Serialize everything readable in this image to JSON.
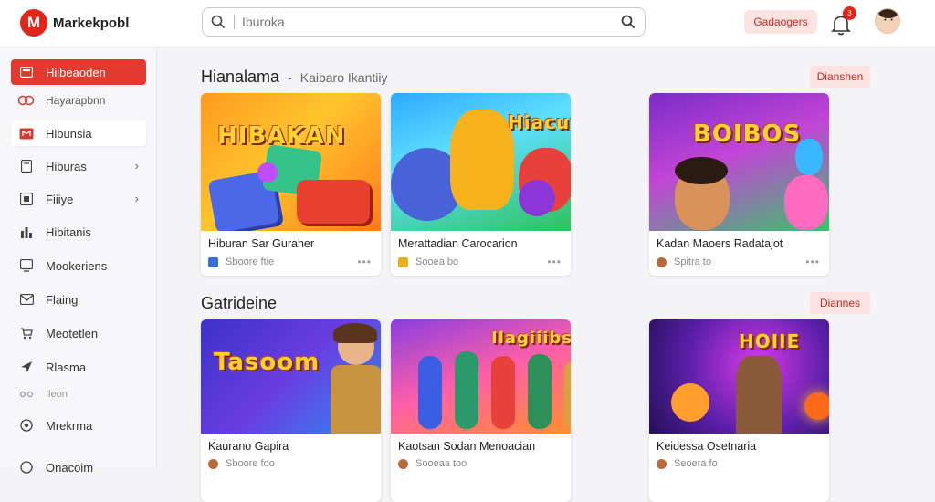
{
  "app": {
    "brand_letter": "M",
    "brand_name": "Markekpobl"
  },
  "search": {
    "placeholder": "Iburoka"
  },
  "header": {
    "action_label": "Gadaogers",
    "notification_count": "3"
  },
  "sidebar": {
    "items": [
      {
        "label": "Hiibeaoden",
        "icon": "home-icon",
        "state": "active"
      },
      {
        "label": "Hayarapbnn",
        "icon": "friends-icon",
        "state": "normal"
      },
      {
        "label": "Hibunsia",
        "icon": "video-icon",
        "state": "selected"
      },
      {
        "label": "Hiburas",
        "icon": "tablet-icon",
        "state": "normal",
        "chevron": true
      },
      {
        "label": "Fiiiye",
        "icon": "grid-icon",
        "state": "normal",
        "chevron": true
      },
      {
        "label": "Hibitanis",
        "icon": "bars-icon",
        "state": "normal"
      },
      {
        "label": "Mookeriens",
        "icon": "monitor-icon",
        "state": "normal"
      },
      {
        "label": "Flaing",
        "icon": "mail-icon",
        "state": "normal"
      },
      {
        "label": "Meotetlen",
        "icon": "cart-icon",
        "state": "normal"
      },
      {
        "label": "Rlasma",
        "icon": "send-icon",
        "state": "normal"
      },
      {
        "label": "Ileon",
        "icon": "link-icon",
        "state": "muted"
      },
      {
        "label": "Mrekrma",
        "icon": "settings-icon",
        "state": "normal"
      },
      {
        "label": "Onacoim",
        "icon": "help-icon",
        "state": "normal"
      }
    ]
  },
  "sections": [
    {
      "title": "Hianalama",
      "subtitle": "Kaibaro Ikantiiy",
      "see_all": "Dianshen",
      "cards": [
        {
          "title": "Hiburan Sar Guraher",
          "meta": "Sboore ftie",
          "meta_color": "#3a6fd8",
          "art": "HIBAKAN"
        },
        {
          "title": "Merattadian Carocarion",
          "meta": "Sooea bo",
          "meta_color": "#e5b21c",
          "art": "Hiacuvay"
        },
        {
          "title": "Kadan Maoers Radatajot",
          "meta": "Spitra to",
          "meta_color": "#b86b3a",
          "art": "BOIBOS"
        }
      ]
    },
    {
      "title": "Gatrideine",
      "subtitle": "",
      "see_all": "Diannes",
      "cards": [
        {
          "title": "Kaurano Gapira",
          "meta": "Sboore foo",
          "meta_color": "#b86b3a",
          "art": "Tasoom"
        },
        {
          "title": "Kaotsan Sodan Menoacian",
          "meta": "Sooeaa too",
          "meta_color": "#b86b3a",
          "art": "Ilagiiibs"
        },
        {
          "title": "Keidessa Osetnaria",
          "meta": "Seoera fo",
          "meta_color": "#b86b3a",
          "art": "HOIIE"
        }
      ]
    }
  ],
  "colors": {
    "accent": "#e23a2e",
    "accent_light": "#fbe3e2",
    "accent_text": "#c62a22"
  }
}
